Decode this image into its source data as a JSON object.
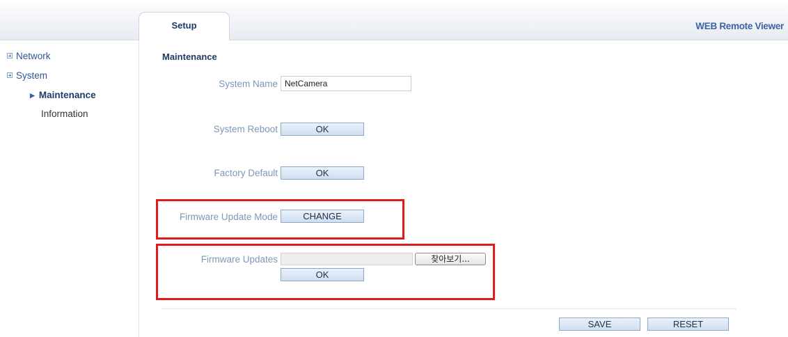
{
  "header": {
    "tab_label": "Setup",
    "app_title": "WEB Remote Viewer"
  },
  "sidebar": {
    "items": [
      {
        "label": "Network"
      },
      {
        "label": "System"
      },
      {
        "label": "Maintenance"
      },
      {
        "label": "Information"
      }
    ]
  },
  "main": {
    "section_title": "Maintenance",
    "system_name": {
      "label": "System Name",
      "value": "NetCamera"
    },
    "system_reboot": {
      "label": "System Reboot",
      "button": "OK"
    },
    "factory_default": {
      "label": "Factory Default",
      "button": "OK"
    },
    "firmware_update_mode": {
      "label": "Firmware Update Mode",
      "button": "CHANGE"
    },
    "firmware_updates": {
      "label": "Firmware Updates",
      "browse_button": "찾아보기...",
      "button": "OK"
    }
  },
  "footer": {
    "save_label": "SAVE",
    "reset_label": "RESET"
  },
  "highlight_color": "#e11b1b"
}
